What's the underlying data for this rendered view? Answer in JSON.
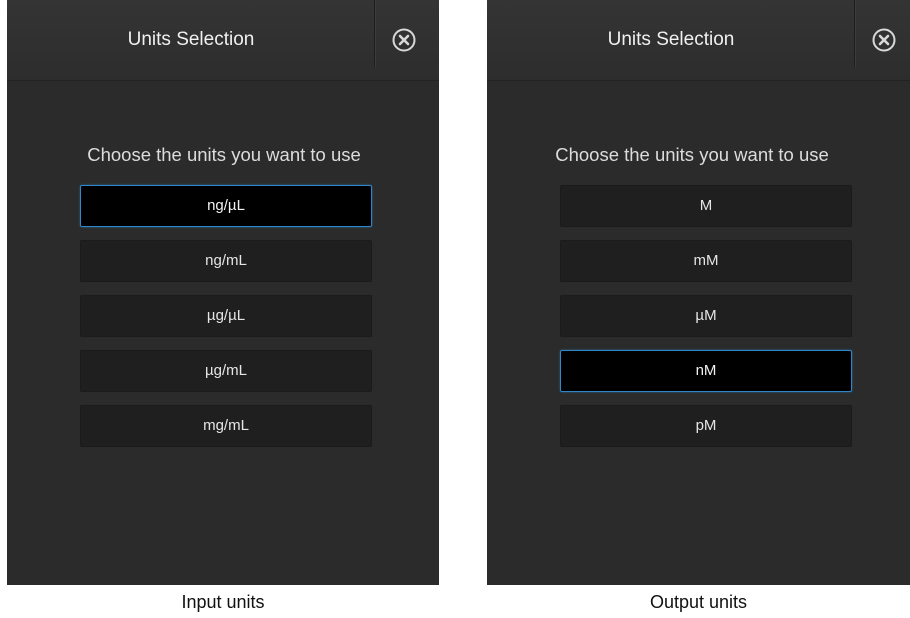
{
  "panels": [
    {
      "title": "Units Selection",
      "prompt": "Choose the units you want to use",
      "options": [
        "ng/µL",
        "ng/mL",
        "µg/µL",
        "µg/mL",
        "mg/mL"
      ],
      "selected": "ng/µL",
      "caption": "Input units"
    },
    {
      "title": "Units Selection",
      "prompt": "Choose the units you want to use",
      "options": [
        "M",
        "mM",
        "µM",
        "nM",
        "pM"
      ],
      "selected": "nM",
      "caption": "Output units"
    }
  ],
  "icons": {
    "close": "close-circle-icon"
  },
  "colors": {
    "panel_background": "#2b2b2b",
    "button_background": "#1f1f1f",
    "selected_background": "#000000",
    "selected_border": "#2f86c8",
    "text": "#e6e6e6"
  }
}
